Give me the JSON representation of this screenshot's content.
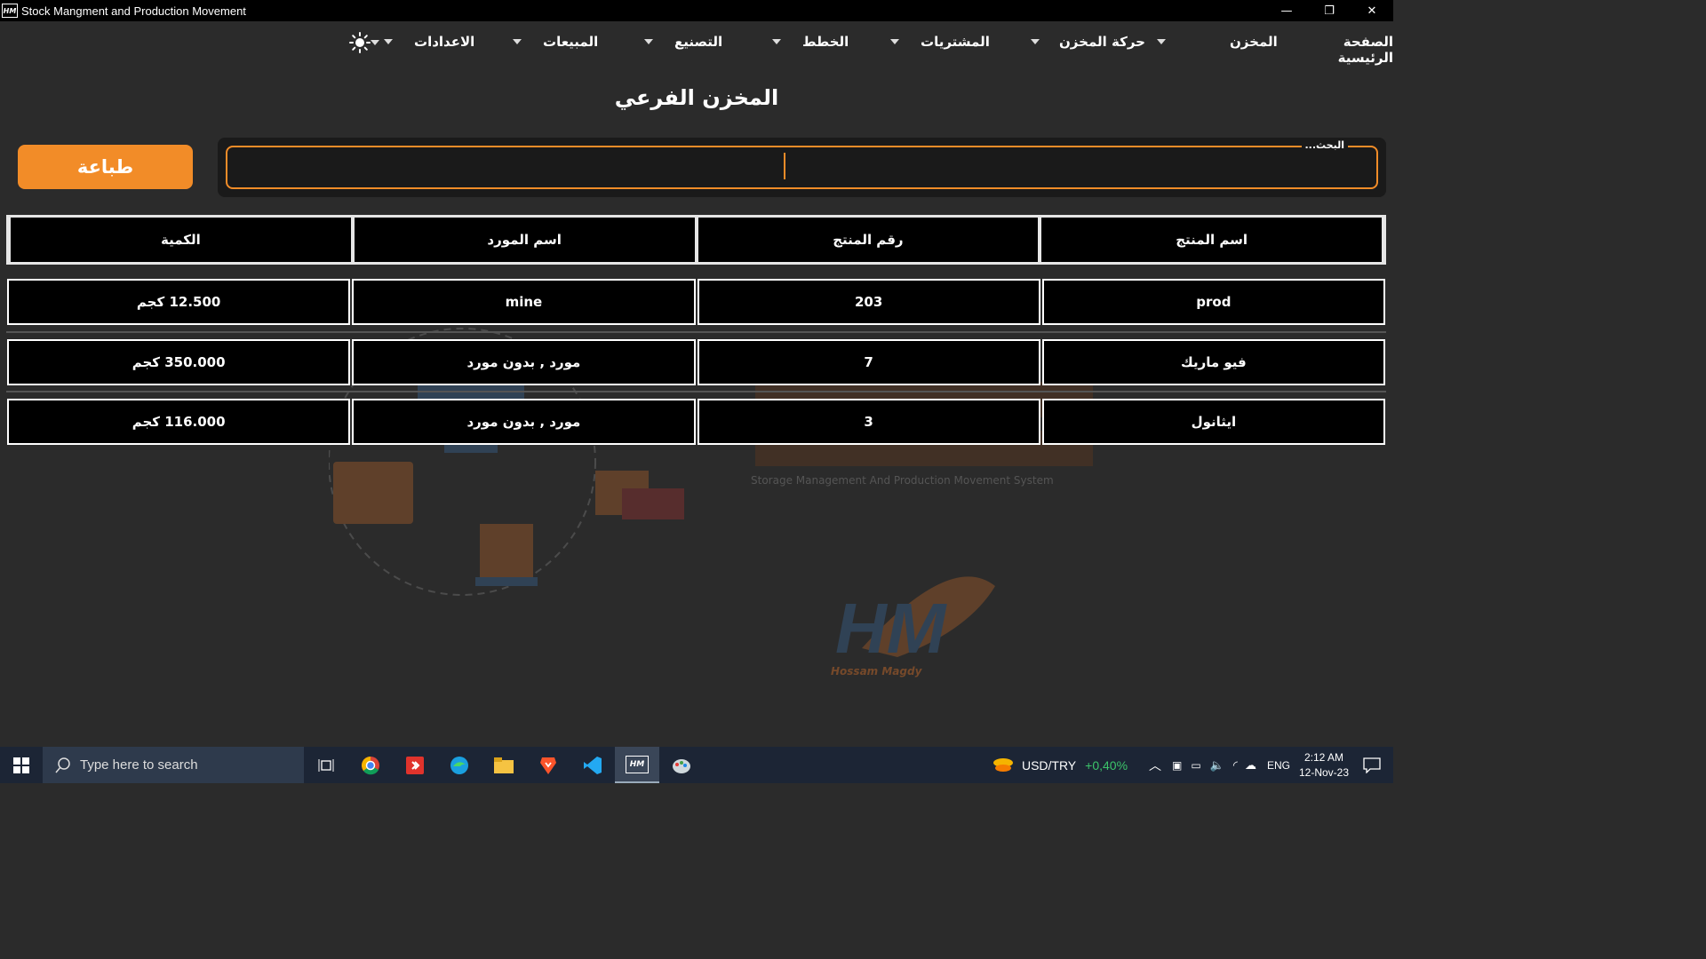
{
  "window": {
    "title": "Stock Mangment and Production Movement",
    "app_icon_text": "HM",
    "minimize": "—",
    "restore": "❐",
    "close": "✕"
  },
  "menu": {
    "items": [
      {
        "label": "الصفحة الرئيسية"
      },
      {
        "label": "المخزن"
      },
      {
        "label": "حركة المخزن"
      },
      {
        "label": "المشتريات"
      },
      {
        "label": "الخطط"
      },
      {
        "label": "التصنيع"
      },
      {
        "label": "المبيعات"
      },
      {
        "label": "الاعدادات"
      }
    ],
    "theme_icon": "sun-icon"
  },
  "page": {
    "title": "المخزن الفرعي",
    "print_label": "طباعة",
    "search_label": "البحث...",
    "search_value": ""
  },
  "table": {
    "headers": [
      "اسم المنتج",
      "رقم المنتج",
      "اسم المورد",
      "الكمية"
    ],
    "rows": [
      [
        "prod",
        "203",
        "mine",
        "12.500 كجم"
      ],
      [
        "فيو ماريك",
        "7",
        "مورد , بدون مورد",
        "350.000 كجم"
      ],
      [
        "ايثانول",
        "3",
        "مورد , بدون مورد",
        "116.000 كجم"
      ]
    ]
  },
  "watermark": {
    "subtitle": "Storage Management And Production Movement System",
    "logo_text": "HM",
    "author": "Hossam Magdy"
  },
  "taskbar": {
    "search_placeholder": "Type here to search",
    "ticker": "USD/TRY",
    "ticker_change": "+0,40%",
    "language": "ENG",
    "time": "2:12 AM",
    "date": "12-Nov-23"
  },
  "colors": {
    "accent": "#f28c28",
    "background": "#2b2b2b",
    "positive": "#3cc46a"
  }
}
